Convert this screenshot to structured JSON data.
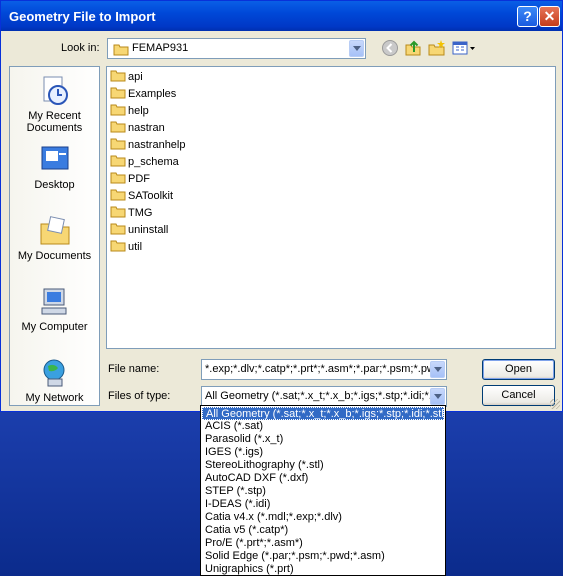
{
  "window": {
    "title": "Geometry File to Import",
    "help_glyph": "?",
    "close_glyph": "✕"
  },
  "toolbar": {
    "look_in_label": "Look in:",
    "look_in_value": "FEMAP931",
    "icons": [
      "back-icon",
      "up-folder-icon",
      "new-folder-icon",
      "views-menu-icon"
    ]
  },
  "places": [
    {
      "label_lines": [
        "My Recent",
        "Documents"
      ],
      "icon": "recent-documents-icon"
    },
    {
      "label_lines": [
        "Desktop"
      ],
      "icon": "desktop-icon"
    },
    {
      "label_lines": [
        "My Documents"
      ],
      "icon": "my-documents-icon"
    },
    {
      "label_lines": [
        "My Computer"
      ],
      "icon": "my-computer-icon"
    },
    {
      "label_lines": [
        "My Network"
      ],
      "icon": "my-network-icon"
    }
  ],
  "files": [
    "api",
    "Examples",
    "help",
    "nastran",
    "nastranhelp",
    "p_schema",
    "PDF",
    "SAToolkit",
    "TMG",
    "uninstall",
    "util"
  ],
  "form": {
    "file_name_label": "File name:",
    "file_name_value": "*.exp;*.dlv;*.catp*;*.prt*;*.asm*;*.par;*.psm;*.pwd",
    "file_type_label": "Files of type:",
    "file_type_value": "All Geometry (*.sat;*.x_t;*.x_b;*.igs;*.stp;*.idi;*.stl;*.dxf",
    "open_label": "Open",
    "cancel_label": "Cancel"
  },
  "type_options": [
    "All Geometry (*.sat;*.x_t;*.x_b;*.igs;*.stp;*.idi;*.stl;*.dxf",
    "ACIS (*.sat)",
    "Parasolid (*.x_t)",
    "IGES (*.igs)",
    "StereoLithography (*.stl)",
    "AutoCAD DXF (*.dxf)",
    "STEP (*.stp)",
    "I-DEAS (*.idi)",
    "Catia v4.x (*.mdl;*.exp;*.dlv)",
    "Catia v5 (*.catp*)",
    "Pro/E (*.prt*;*.asm*)",
    "Solid Edge (*.par;*.psm;*.pwd;*.asm)",
    "Unigraphics (*.prt)"
  ],
  "colors": {
    "titlebar": "#0048d8",
    "selection": "#316ac5",
    "dialog": "#ece9d8"
  }
}
